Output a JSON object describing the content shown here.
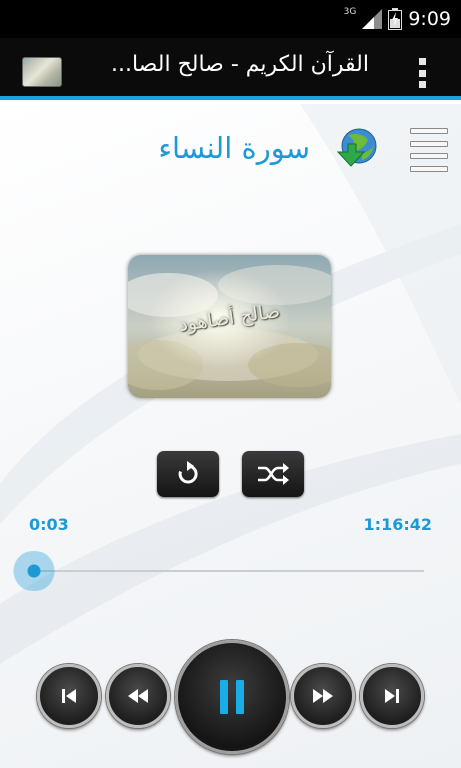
{
  "status_bar": {
    "network": "3G",
    "time": "9:09"
  },
  "action_bar": {
    "title": "القرآن الكريم - صالح الصا..."
  },
  "player": {
    "surah_name": "سورة النساء",
    "cover_caption": "صالح أصاهود",
    "elapsed": "0:03",
    "duration": "1:16:42",
    "progress_fraction": 0.0007
  },
  "icons": {
    "menu": "menu-icon",
    "download": "globe-download-icon",
    "repeat": "repeat-icon",
    "shuffle": "shuffle-icon",
    "previous": "skip-previous-icon",
    "rewind": "rewind-icon",
    "pause": "pause-icon",
    "fast_forward": "fast-forward-icon",
    "next": "skip-next-icon",
    "overflow": "overflow-menu-icon"
  },
  "colors": {
    "accent": "#1c9ad6",
    "action_bar_underline": "#1aa3de",
    "pause_glyph": "#19aee8"
  }
}
